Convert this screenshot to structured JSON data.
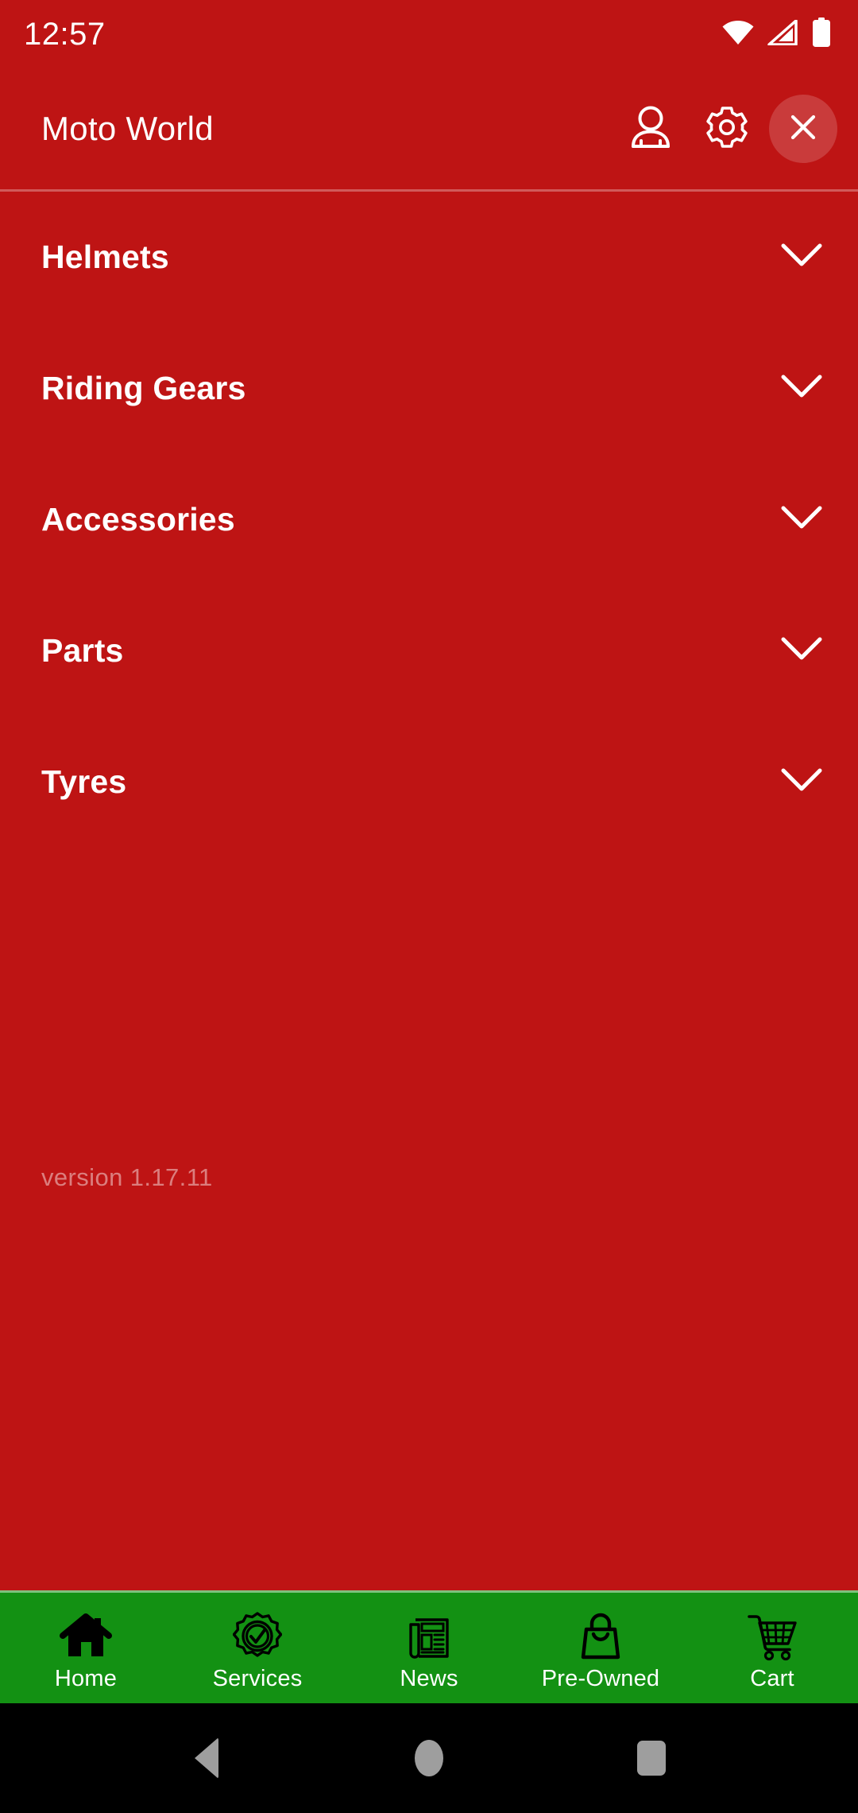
{
  "status_bar": {
    "time": "12:57",
    "icons": [
      "wifi-icon",
      "cellular-signal-icon",
      "battery-icon"
    ]
  },
  "header": {
    "title": "Moto World",
    "actions": [
      {
        "name": "account-icon",
        "label": "Account"
      },
      {
        "name": "settings-gear-icon",
        "label": "Settings"
      },
      {
        "name": "close-icon",
        "label": "Close"
      }
    ]
  },
  "menu": {
    "items": [
      {
        "label": "Helmets",
        "expand_icon": "chevron-down-icon"
      },
      {
        "label": "Riding Gears",
        "expand_icon": "chevron-down-icon"
      },
      {
        "label": "Accessories",
        "expand_icon": "chevron-down-icon"
      },
      {
        "label": "Parts",
        "expand_icon": "chevron-down-icon"
      },
      {
        "label": "Tyres",
        "expand_icon": "chevron-down-icon"
      }
    ],
    "version": "version 1.17.11"
  },
  "tab_bar": {
    "items": [
      {
        "label": "Home",
        "icon": "home-icon"
      },
      {
        "label": "Services",
        "icon": "badge-check-icon"
      },
      {
        "label": "News",
        "icon": "newspaper-icon"
      },
      {
        "label": "Pre-Owned",
        "icon": "shopping-bag-icon"
      },
      {
        "label": "Cart",
        "icon": "shopping-cart-icon"
      }
    ]
  },
  "system_nav": {
    "back": "back-triangle-icon",
    "home": "home-circle-icon",
    "recents": "recents-square-icon"
  },
  "colors": {
    "brand_red": "#BE1414",
    "tab_green": "#139113",
    "text_white": "#FFFFFF",
    "version_text": "rgba(255,255,255,0.45)",
    "nav_grey": "#9E9E9E",
    "system_black": "#000000"
  }
}
